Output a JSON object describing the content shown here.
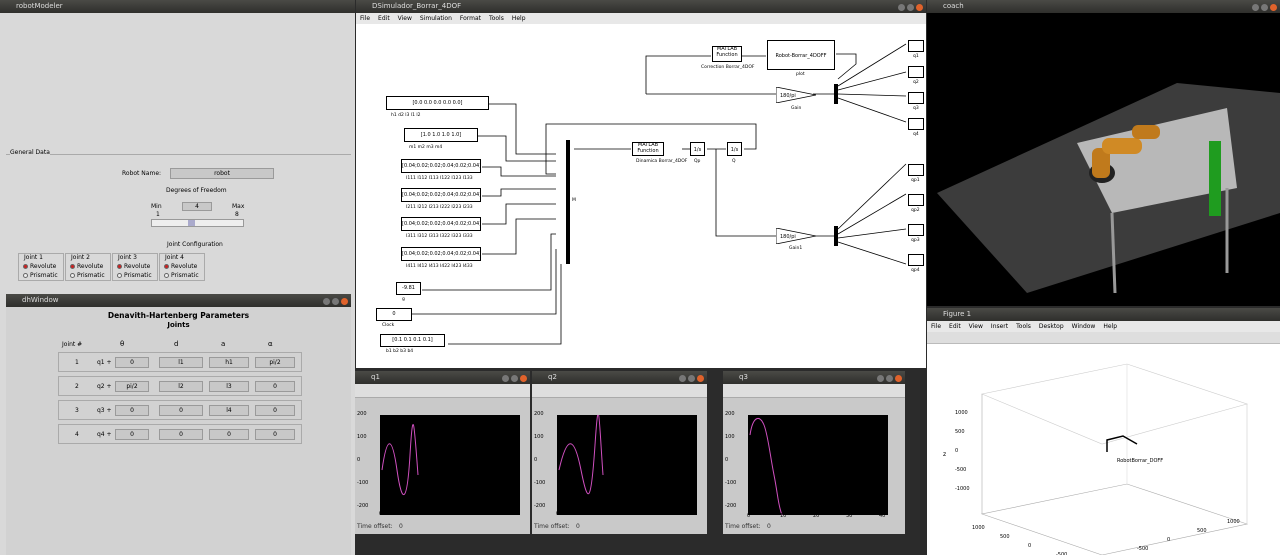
{
  "robotModeler": {
    "title": "robotModeler",
    "general_label": "General Data",
    "robot_name_label": "Robot Name:",
    "robot_name_value": "robot",
    "dof_label": "Degrees of Freedom",
    "min_label": "Min",
    "min_value": "1",
    "max_label": "Max",
    "max_value": "8",
    "dof_value": "4",
    "joint_config_label": "Joint Configuration",
    "joints": [
      "Joint 1",
      "Joint 2",
      "Joint 3",
      "Joint 4"
    ],
    "revolute": "Revolute",
    "prismatic": "Prismatic"
  },
  "dhWindow": {
    "title": "dhWindow",
    "heading": "Denavith-Hartenberg Parameters",
    "subheading": "Joints",
    "headers": [
      "Joint #",
      "θ",
      "d",
      "a",
      "α"
    ],
    "rows": [
      {
        "n": "1",
        "q": "q1 +",
        "theta": "0",
        "d": "l1",
        "a": "h1",
        "alpha": "pi/2"
      },
      {
        "n": "2",
        "q": "q2 +",
        "theta": "pi/2",
        "d": "l2",
        "a": "l3",
        "alpha": "0"
      },
      {
        "n": "3",
        "q": "q3 +",
        "theta": "0",
        "d": "0",
        "a": "l4",
        "alpha": "0"
      },
      {
        "n": "4",
        "q": "q4 +",
        "theta": "0",
        "d": "0",
        "a": "0",
        "alpha": "0"
      }
    ]
  },
  "simulink": {
    "title": "DSimulador_Borrar_4DOF",
    "menu": [
      "File",
      "Edit",
      "View",
      "Simulation",
      "Format",
      "Tools",
      "Help"
    ],
    "consts": [
      {
        "v": "[0.0  0.0  0.0  0.0  0.0]",
        "l": "h1 d2 l3 l1 l2"
      },
      {
        "v": "[1.0  1.0  1.0  1.0]",
        "l": "m1 m2 m3 m4"
      },
      {
        "v": "[0.04;0.02;0.02;0.04;0.02;0.04]",
        "l": "I111 I112 I113 I122 I123 I133"
      },
      {
        "v": "[0.04;0.02;0.02;0.04;0.02;0.04]",
        "l": "I211 I212 I213 I222 I223 I233"
      },
      {
        "v": "[0.04;0.02;0.02;0.04;0.02;0.04]",
        "l": "I311 I312 I313 I322 I323 I333"
      },
      {
        "v": "[0.04;0.02;0.02;0.04;0.02;0.04]",
        "l": "I411 I412 I413 I422 I423 I433"
      }
    ],
    "gravity": {
      "v": "-9.81",
      "l": "g"
    },
    "clock": {
      "v": "0",
      "l": "Clock"
    },
    "friction": {
      "v": "[0.1  0.1  0.1  0.1]",
      "l": "b1 b2 b3 b4"
    },
    "matlab_fn": "MATLAB Function",
    "dyn_label": "Dinamica Borrar_4DOF",
    "corr_label": "Correction Borrar_4DOF",
    "robot_block": "Robot-Borrar_4DOFF",
    "plot_label": "plot",
    "int1": "1/s",
    "int1_label": "Qp",
    "int2": "1/s",
    "int2_label": "Q",
    "gain_val": "180/pi",
    "gain_label": "Gain",
    "gain1_label": "Gain1",
    "outs": [
      "q1",
      "q2",
      "q3",
      "q4"
    ],
    "outs2": [
      "qp1",
      "qp2",
      "qp3",
      "qp4"
    ],
    "mux_label": "M"
  },
  "coach": {
    "title": "coach"
  },
  "figure1": {
    "title": "Figure 1",
    "menu": [
      "File",
      "Edit",
      "View",
      "Insert",
      "Tools",
      "Desktop",
      "Window",
      "Help"
    ],
    "zlabel": "z",
    "obj_label": "RobotBorrar_DOFF",
    "zticks": [
      "1000",
      "500",
      "0",
      "-500",
      "-1000"
    ],
    "xticks": [
      "1000",
      "500",
      "0",
      "-500"
    ],
    "yticks": [
      "-500",
      "0",
      "500",
      "1000"
    ]
  },
  "scopes": [
    {
      "title": "q1",
      "offset_label": "Time offset:",
      "offset": "0"
    },
    {
      "title": "q2",
      "offset_label": "Time offset:",
      "offset": "0"
    },
    {
      "title": "q3",
      "offset_label": "Time offset:",
      "offset": "0"
    }
  ],
  "scope_axis": {
    "yticks": [
      "200",
      "100",
      "0",
      "-100",
      "-200"
    ],
    "xticks": [
      "0",
      "10",
      "20",
      "30",
      "40"
    ]
  }
}
